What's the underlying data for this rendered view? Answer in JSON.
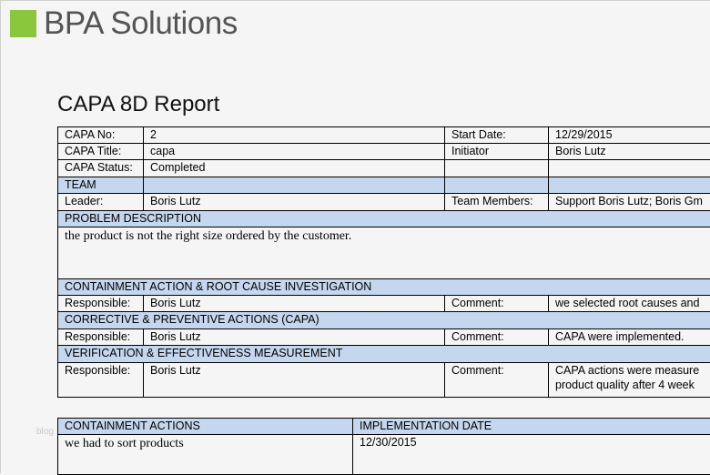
{
  "brand": {
    "name": "BPA Solutions",
    "color": "#8cc63f"
  },
  "report_title": "CAPA 8D Report",
  "header_fill": "#c5d7ef",
  "fields": {
    "capa_no_label": "CAPA No:",
    "capa_no": "2",
    "start_date_label": "Start Date:",
    "start_date": "12/29/2015",
    "capa_title_label": "CAPA Title:",
    "capa_title": "capa",
    "initiator_label": "Initiator",
    "initiator": "Boris Lutz",
    "capa_status_label": "CAPA Status:",
    "capa_status": "Completed"
  },
  "team": {
    "header": "TEAM",
    "leader_label": "Leader:",
    "leader": "Boris Lutz",
    "members_label": "Team Members:",
    "members": "Support Boris Lutz; Boris Gm"
  },
  "problem": {
    "header": "PROBLEM DESCRIPTION",
    "text": "the product is not the right  size ordered by the customer."
  },
  "containment": {
    "header": "CONTAINMENT ACTION & ROOT CAUSE INVESTIGATION",
    "responsible_label": "Responsible:",
    "responsible": "Boris Lutz",
    "comment_label": "Comment:",
    "comment": "we selected root causes and"
  },
  "corrective": {
    "header": "CORRECTIVE & PREVENTIVE ACTIONS (CAPA)",
    "responsible_label": "Responsible:",
    "responsible": "Boris Lutz",
    "comment_label": "Comment:",
    "comment": "CAPA were implemented."
  },
  "verification": {
    "header": "VERIFICATION & EFFECTIVENESS MEASUREMENT",
    "responsible_label": "Responsible:",
    "responsible": "Boris Lutz",
    "comment_label": "Comment:",
    "comment_line1": "CAPA actions were measure",
    "comment_line2": "product quality after 4 week"
  },
  "actions_table": {
    "col1": "CONTAINMENT ACTIONS",
    "col2": "IMPLEMENTATION DATE",
    "rows": [
      {
        "action": "we had to sort products",
        "date": "12/30/2015"
      }
    ]
  },
  "watermark": "blog"
}
